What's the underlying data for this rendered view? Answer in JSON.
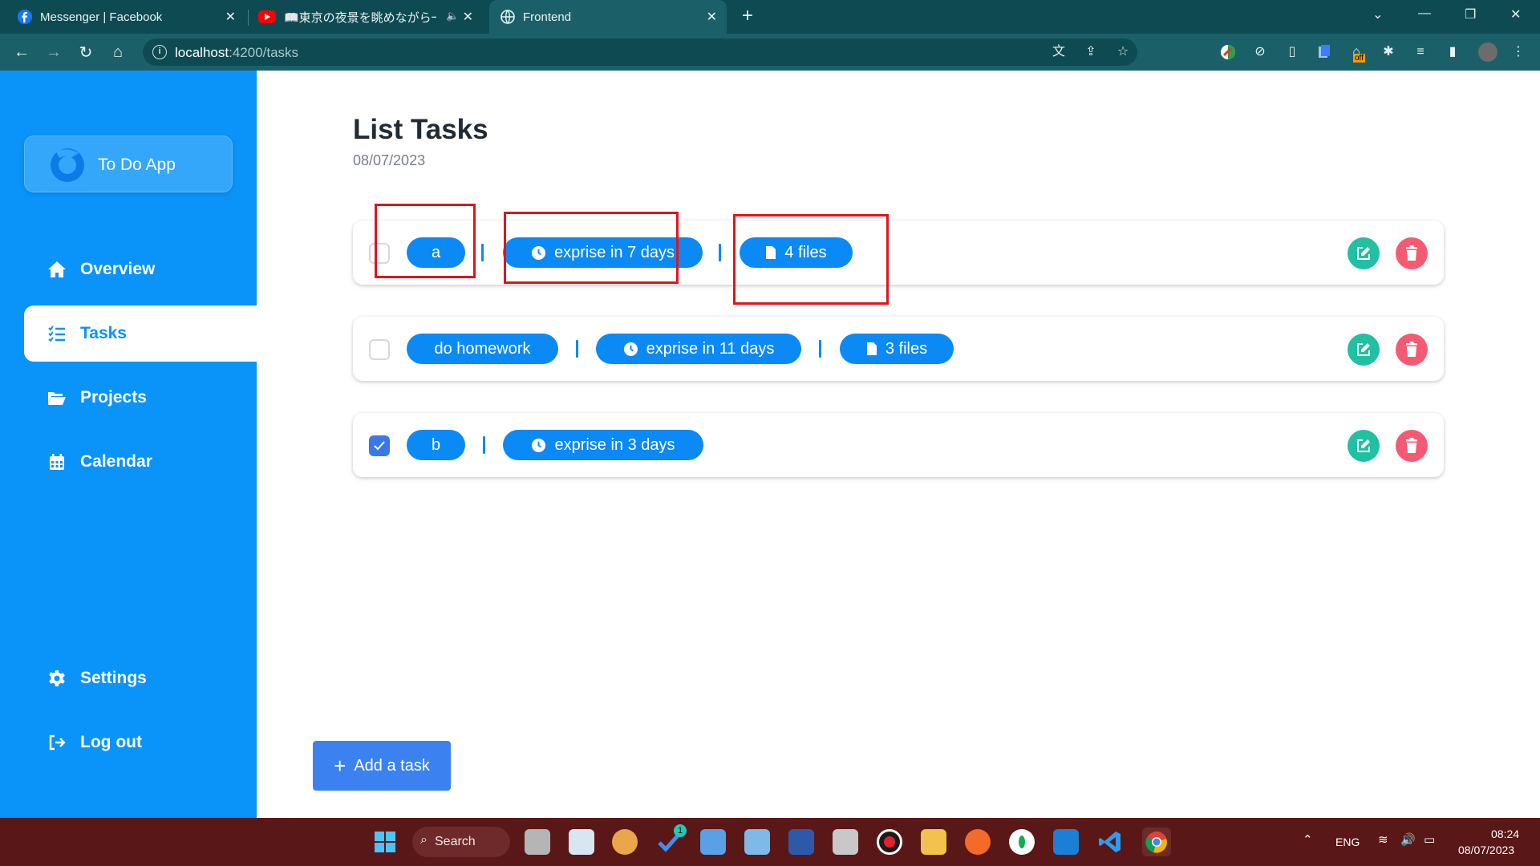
{
  "browser": {
    "tabs": [
      {
        "title": "Messenger | Facebook",
        "favicon": "facebook-icon",
        "active": false
      },
      {
        "title": "📖東京の夜景を眺めながら一",
        "favicon": "youtube-icon",
        "active": false,
        "muted_icon": "speaker-icon"
      },
      {
        "title": "Frontend",
        "favicon": "globe-icon",
        "active": true
      }
    ],
    "url_host": "localhost",
    "url_path": ":4200/tasks"
  },
  "app": {
    "logo_text": "To Do App",
    "nav": [
      {
        "label": "Overview",
        "icon": "home-icon",
        "active": false
      },
      {
        "label": "Tasks",
        "icon": "task-list-icon",
        "active": true
      },
      {
        "label": "Projects",
        "icon": "folder-open-icon",
        "active": false
      },
      {
        "label": "Calendar",
        "icon": "calendar-icon",
        "active": false
      }
    ],
    "bottom_nav": [
      {
        "label": "Settings",
        "icon": "gear-icon"
      },
      {
        "label": "Log out",
        "icon": "logout-icon"
      }
    ],
    "colors": {
      "sidebar": "#0a93f8",
      "pill": "#0b8af5",
      "edit": "#22c0a2",
      "delete": "#f45b73",
      "annotation": "#e0141d"
    }
  },
  "main": {
    "title": "List Tasks",
    "date": "08/07/2023",
    "tasks": [
      {
        "name": "a",
        "checked": false,
        "expiry": "exprise in 7 days",
        "files": "4 files"
      },
      {
        "name": "do homework",
        "checked": false,
        "expiry": "exprise in 11 days",
        "files": "3 files"
      },
      {
        "name": "b",
        "checked": true,
        "expiry": "exprise in 3 days",
        "files": null
      }
    ],
    "add_button": "Add a task"
  },
  "taskbar": {
    "search_label": "Search",
    "language": "ENG",
    "time": "08:24",
    "date": "08/07/2023",
    "badge_count": "1",
    "extension_badge": "off"
  }
}
